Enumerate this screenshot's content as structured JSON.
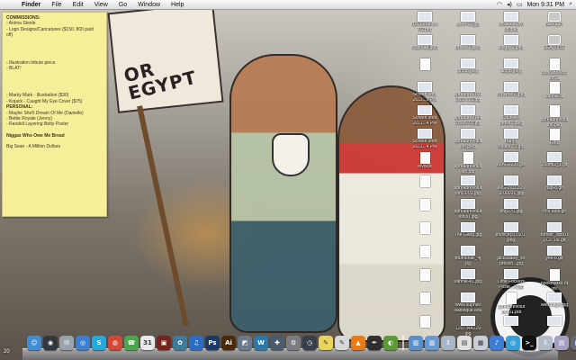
{
  "menubar": {
    "apple": "",
    "items": [
      "Finder",
      "File",
      "Edit",
      "View",
      "Go",
      "Window",
      "Help"
    ],
    "clock": "Mon 9:31 PM",
    "status_icons": [
      "wifi-icon",
      "volume-icon",
      "battery-icon",
      "search-icon"
    ]
  },
  "wallpaper": {
    "sign_text": "OR EGYPT"
  },
  "sticky": {
    "lines": [
      {
        "t": "COMMISSIONS:",
        "h": true
      },
      {
        "t": "- Anima Steele"
      },
      {
        "t": "     - Logo Designs/Caricatures ($150, 800 paid"
      },
      {
        "t": "off)"
      },
      {
        "t": "",
        "g": true
      },
      {
        "t": "",
        "g": true
      },
      {
        "t": "",
        "g": true
      },
      {
        "t": "",
        "g": true
      },
      {
        "t": "- Illustration tribute piece"
      },
      {
        "t": "- BLAT!"
      },
      {
        "t": "",
        "g": true
      },
      {
        "t": "",
        "g": true
      },
      {
        "t": "",
        "g": true
      },
      {
        "t": "",
        "g": true
      },
      {
        "t": "- Marky Mark - Illustration ($30)"
      },
      {
        "t": "- Kojack - Caught My Eye Cover ($75)"
      },
      {
        "t": "PERSONAL:",
        "h": true
      },
      {
        "t": "- Maybe She'll Dream Of Me (Danielle)"
      },
      {
        "t": "- Bettie Royale (Jenny)"
      },
      {
        "t": "- Randell Layering Betty Poster"
      },
      {
        "t": "",
        "g": true
      },
      {
        "t": "Niggas Who Owe Me Bread",
        "h": true
      },
      {
        "t": "",
        "g": true
      },
      {
        "t": "Big Sean - A Million Dollars"
      }
    ]
  },
  "desktop_icons": [
    {
      "l1": "rt2010banner",
      "l2": "-02.png",
      "k": "img"
    },
    {
      "l1": "open-01.jpg",
      "l2": "",
      "k": "img"
    },
    {
      "l1": "affiliatetouch",
      "l2": "up.jpeg",
      "k": "img"
    },
    {
      "l1": "Backup 5",
      "l2": "",
      "k": "disk"
    },
    {
      "l1": "rcspread.jpeg",
      "l2": "",
      "k": "img"
    },
    {
      "l1": "photo-1.jpeg",
      "l2": "",
      "k": "img"
    },
    {
      "l1": "alogo_1.jpeg",
      "l2": "",
      "k": "img"
    },
    {
      "l1": "SEA_DISC",
      "l2": "",
      "k": "disk"
    },
    {
      "l1": "",
      "l2": "",
      "k": "doc"
    },
    {
      "l1": "photo.jpeg",
      "l2": "",
      "k": "img"
    },
    {
      "l1": "alogo.jpeg",
      "l2": "",
      "k": "img"
    },
    {
      "l1": "spreadrevolt",
      "l2": "ion.ai",
      "k": "doc"
    },
    {
      "l1": "Screen shot",
      "l2": "2011...9 PM",
      "k": "img"
    },
    {
      "l1": "spreadrev100",
      "l2": "0x80...01.jpg",
      "k": "img"
    },
    {
      "l1": "chowder2.jpeg",
      "l2": "",
      "k": "img"
    },
    {
      "l1": "vannie.ai",
      "l2": "",
      "k": "doc"
    },
    {
      "l1": "Screen shot",
      "l2": "2011...4 PM",
      "k": "img"
    },
    {
      "l1": "spreadrev144",
      "l2": "0x900-02.jpg",
      "k": "img"
    },
    {
      "l1": "Couriier--",
      "l2": "prove...jpeg",
      "k": "img"
    },
    {
      "l1": "spreadrevolut",
      "l2": "ion.psd",
      "k": "doc"
    },
    {
      "l1": "Screen shot",
      "l2": "2011...4 PM",
      "k": "img"
    },
    {
      "l1": "spreadrevolut",
      "l2": "ion.jpeg",
      "k": "img"
    },
    {
      "l1": "Happy",
      "l2": "Belate...1.jpg",
      "k": "img"
    },
    {
      "l1": "Refs",
      "l2": "",
      "k": "doc"
    },
    {
      "l1": "Invoice",
      "l2": "",
      "k": "doc"
    },
    {
      "l1": "spreadrevolut",
      "l2": "ion.pdf",
      "k": "doc"
    },
    {
      "l1": "IMAG0239.jpe",
      "l2": "",
      "k": "img"
    },
    {
      "l1": "258ml2_1.gif",
      "l2": "",
      "k": "img"
    },
    {
      "l1": "",
      "l2": "",
      "k": "doc"
    },
    {
      "l1": "spreadrevolut",
      "l2": "ion01-01.jpg",
      "k": "img"
    },
    {
      "l1": "IMG-2010320",
      "l2": "3-00031.jpg",
      "k": "img"
    },
    {
      "l1": "dap-o.gif",
      "l2": "",
      "k": "img"
    },
    {
      "l1": "",
      "l2": "",
      "k": "doc"
    },
    {
      "l1": "spreadrevolut",
      "l2": "ion(s).jpg",
      "k": "img"
    },
    {
      "l1": "img270.jpg",
      "l2": "",
      "k": "img"
    },
    {
      "l1": "rico.tabs.gif",
      "l2": "",
      "k": "img"
    },
    {
      "l1": "",
      "l2": "",
      "k": "doc"
    },
    {
      "l1": "The Gang.jpg",
      "l2": "",
      "k": "img"
    },
    {
      "l1": "invoice(s)1501.",
      "l2": "png",
      "k": "img"
    },
    {
      "l1": "tumblr_ldpb1l",
      "l2": "ZCI...06.gif",
      "k": "img"
    },
    {
      "l1": "",
      "l2": "",
      "k": "doc"
    },
    {
      "l1": "thumbnail_4j",
      "l2": "pg",
      "k": "img"
    },
    {
      "l1": "jacksdaisy_ex",
      "l2": "presso...jpg",
      "k": "img"
    },
    {
      "l1": "yes-o.gif",
      "l2": "",
      "k": "img"
    },
    {
      "l1": "",
      "l2": "",
      "k": "doc"
    },
    {
      "l1": "vannie-e1.jpg",
      "l2": "",
      "k": "img"
    },
    {
      "l1": "Little Fockers",
      "l2": "Poste...e.jpg",
      "k": "img"
    },
    {
      "l1": "bookmarks.ht",
      "l2": "ml",
      "k": "doc"
    },
    {
      "l1": "",
      "l2": "",
      "k": "doc"
    },
    {
      "l1": "www.supnav",
      "l2": "illabloque.edu",
      "k": "img"
    },
    {
      "l1": "spreadrevolut",
      "l2": "ion-01.pdf",
      "k": "doc"
    },
    {
      "l1": "web-page.jpg",
      "l2": "",
      "k": "img"
    },
    {
      "l1": "",
      "l2": "",
      "k": "doc"
    },
    {
      "l1": "1207344229",
      "l2": "jpg",
      "k": "img"
    },
    {
      "l1": "",
      "l2": "",
      "k": "img"
    },
    {
      "l1": "",
      "l2": "",
      "k": "img"
    }
  ],
  "dock": {
    "left_number": "20",
    "items": [
      {
        "n": "finder",
        "c": "#3f8ed6",
        "g": "☺"
      },
      {
        "n": "dashboard",
        "c": "#33383f",
        "g": "◉"
      },
      {
        "n": "mail",
        "c": "#9aa4ad",
        "g": "✉"
      },
      {
        "n": "safari",
        "c": "#3c7fcc",
        "g": "◎"
      },
      {
        "n": "skype",
        "c": "#27a8e0",
        "g": "S"
      },
      {
        "n": "chrome",
        "c": "#d4483a",
        "g": "◍"
      },
      {
        "n": "ichat",
        "c": "#4aa74c",
        "g": "☎"
      },
      {
        "n": "ical",
        "c": "#e8e8e8",
        "g": "31"
      },
      {
        "n": "photo-booth",
        "c": "#77221c",
        "g": "▣"
      },
      {
        "n": "iphoto",
        "c": "#3d7a9a",
        "g": "✿"
      },
      {
        "n": "itunes",
        "c": "#2a6bc4",
        "g": "♫"
      },
      {
        "n": "photoshop",
        "c": "#1b3a67",
        "g": "Ps"
      },
      {
        "n": "illustrator",
        "c": "#4a2a08",
        "g": "Ai"
      },
      {
        "n": "preview",
        "c": "#6a7a8c",
        "g": "◩"
      },
      {
        "n": "wordpress",
        "c": "#2a79a8",
        "g": "W"
      },
      {
        "n": "app-store",
        "c": "#4a5b6c",
        "g": "✚"
      },
      {
        "n": "system-prefs",
        "c": "#7a7e84",
        "g": "⚙"
      },
      {
        "n": "time-machine",
        "c": "#35404a",
        "g": "◷"
      },
      {
        "n": "stickies",
        "c": "#e9d45e",
        "g": "✎"
      },
      {
        "n": "textedit",
        "c": "#d7d7d7",
        "g": "✎"
      },
      {
        "n": "vlc",
        "c": "#e87b13",
        "g": "▲"
      },
      {
        "n": "feather",
        "c": "#2f2f2f",
        "g": "✒"
      },
      {
        "n": "adium",
        "c": "#5a9a37",
        "g": "◐"
      },
      {
        "n": "sep"
      },
      {
        "n": "applications-stack",
        "c": "#5a8fc9",
        "g": "▥"
      },
      {
        "n": "documents-stack",
        "c": "#6a99cf",
        "g": "▥"
      },
      {
        "n": "downloads-stack",
        "c": "#a9b6c5",
        "g": "⇩"
      },
      {
        "n": "file-stack",
        "c": "#e0e0e0",
        "g": "▤"
      },
      {
        "n": "image-stack",
        "c": "#c9cfd6",
        "g": "▦"
      },
      {
        "n": "music-stack",
        "c": "#3e7bd2",
        "g": "♪"
      },
      {
        "n": "globe",
        "c": "#3aa0d9",
        "g": "◎"
      },
      {
        "n": "terminal",
        "c": "#111",
        "g": ">_"
      },
      {
        "n": "downloads",
        "c": "#b3bcc8",
        "g": "⇩"
      },
      {
        "n": "photo-stack",
        "c": "#a5a0c2",
        "g": "▤"
      },
      {
        "n": "movie-stack",
        "c": "#656a79",
        "g": "▶"
      },
      {
        "n": "trash",
        "c": "#c9ced4",
        "g": "♲"
      }
    ]
  }
}
